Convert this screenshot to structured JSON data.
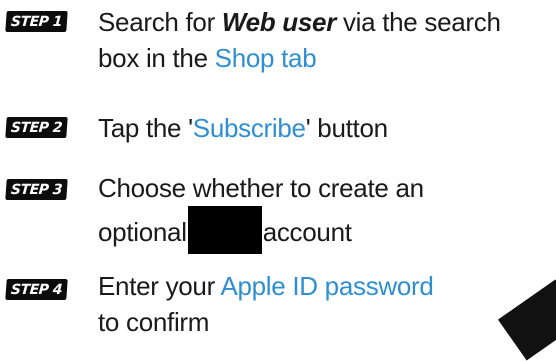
{
  "steps": [
    {
      "badge": "STEP 1",
      "line1_a": "Search for ",
      "line1_em": "Web user",
      "line1_b": " via the search",
      "line2_a": "box in the ",
      "line2_hl": "Shop tab"
    },
    {
      "badge": "STEP 2",
      "a": "Tap the '",
      "hl": "Subscribe",
      "b": "' button"
    },
    {
      "badge": "STEP 3",
      "line1": "Choose whether to create an",
      "line2_a": "optional",
      "line2_b": "account"
    },
    {
      "badge": "STEP 4",
      "line1_a": "Enter your ",
      "line1_hl": "Apple ID password",
      "line2": "to confirm"
    }
  ],
  "colors": {
    "highlight": "#2f8fd1",
    "badge_bg": "#0c0c0c",
    "text": "#1a1a1a"
  }
}
